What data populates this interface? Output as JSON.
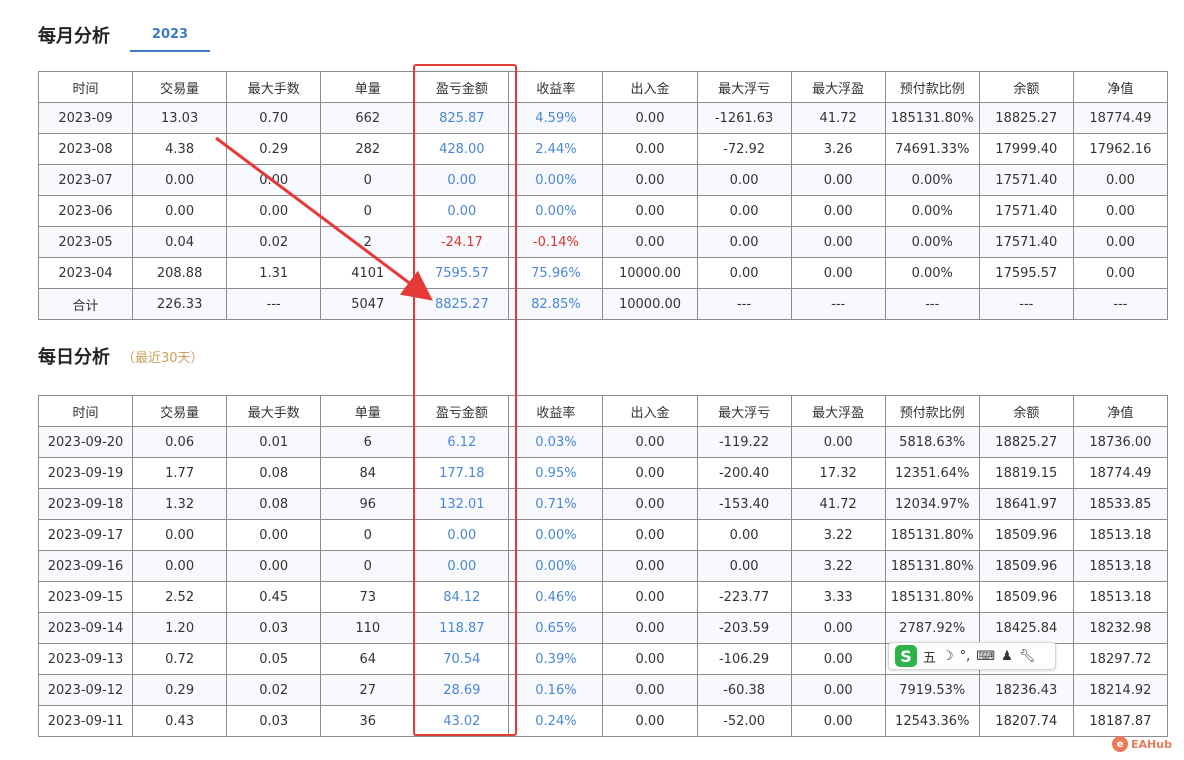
{
  "monthly": {
    "title": "每月分析",
    "year_tab": "2023",
    "headers": [
      "时间",
      "交易量",
      "最大手数",
      "单量",
      "盈亏金额",
      "收益率",
      "出入金",
      "最大浮亏",
      "最大浮盈",
      "预付款比例",
      "余额",
      "净值"
    ],
    "rows": [
      [
        "2023-09",
        "13.03",
        "0.70",
        "662",
        "825.87",
        "4.59%",
        "0.00",
        "-1261.63",
        "41.72",
        "185131.80%",
        "18825.27",
        "18774.49"
      ],
      [
        "2023-08",
        "4.38",
        "0.29",
        "282",
        "428.00",
        "2.44%",
        "0.00",
        "-72.92",
        "3.26",
        "74691.33%",
        "17999.40",
        "17962.16"
      ],
      [
        "2023-07",
        "0.00",
        "0.00",
        "0",
        "0.00",
        "0.00%",
        "0.00",
        "0.00",
        "0.00",
        "0.00%",
        "17571.40",
        "0.00"
      ],
      [
        "2023-06",
        "0.00",
        "0.00",
        "0",
        "0.00",
        "0.00%",
        "0.00",
        "0.00",
        "0.00",
        "0.00%",
        "17571.40",
        "0.00"
      ],
      [
        "2023-05",
        "0.04",
        "0.02",
        "2",
        "-24.17",
        "-0.14%",
        "0.00",
        "0.00",
        "0.00",
        "0.00%",
        "17571.40",
        "0.00"
      ],
      [
        "2023-04",
        "208.88",
        "1.31",
        "4101",
        "7595.57",
        "75.96%",
        "10000.00",
        "0.00",
        "0.00",
        "0.00%",
        "17595.57",
        "0.00"
      ],
      [
        "合计",
        "226.33",
        "---",
        "5047",
        "8825.27",
        "82.85%",
        "10000.00",
        "---",
        "---",
        "---",
        "---",
        "---"
      ]
    ]
  },
  "daily": {
    "title": "每日分析",
    "subtitle": "（最近30天）",
    "headers": [
      "时间",
      "交易量",
      "最大手数",
      "单量",
      "盈亏金额",
      "收益率",
      "出入金",
      "最大浮亏",
      "最大浮盈",
      "预付款比例",
      "余额",
      "净值"
    ],
    "rows": [
      [
        "2023-09-20",
        "0.06",
        "0.01",
        "6",
        "6.12",
        "0.03%",
        "0.00",
        "-119.22",
        "0.00",
        "5818.63%",
        "18825.27",
        "18736.00"
      ],
      [
        "2023-09-19",
        "1.77",
        "0.08",
        "84",
        "177.18",
        "0.95%",
        "0.00",
        "-200.40",
        "17.32",
        "12351.64%",
        "18819.15",
        "18774.49"
      ],
      [
        "2023-09-18",
        "1.32",
        "0.08",
        "96",
        "132.01",
        "0.71%",
        "0.00",
        "-153.40",
        "41.72",
        "12034.97%",
        "18641.97",
        "18533.85"
      ],
      [
        "2023-09-17",
        "0.00",
        "0.00",
        "0",
        "0.00",
        "0.00%",
        "0.00",
        "0.00",
        "3.22",
        "185131.80%",
        "18509.96",
        "18513.18"
      ],
      [
        "2023-09-16",
        "0.00",
        "0.00",
        "0",
        "0.00",
        "0.00%",
        "0.00",
        "0.00",
        "3.22",
        "185131.80%",
        "18509.96",
        "18513.18"
      ],
      [
        "2023-09-15",
        "2.52",
        "0.45",
        "73",
        "84.12",
        "0.46%",
        "0.00",
        "-223.77",
        "3.33",
        "185131.80%",
        "18509.96",
        "18513.18"
      ],
      [
        "2023-09-14",
        "1.20",
        "0.03",
        "110",
        "118.87",
        "0.65%",
        "0.00",
        "-203.59",
        "0.00",
        "2787.92%",
        "18425.84",
        "18232.98"
      ],
      [
        "2023-09-13",
        "0.72",
        "0.05",
        "64",
        "70.54",
        "0.39%",
        "0.00",
        "-106.29",
        "0.00",
        "",
        "",
        "18297.72"
      ],
      [
        "2023-09-12",
        "0.29",
        "0.02",
        "27",
        "28.69",
        "0.16%",
        "0.00",
        "-60.38",
        "0.00",
        "7919.53%",
        "18236.43",
        "18214.92"
      ],
      [
        "2023-09-11",
        "0.43",
        "0.03",
        "36",
        "43.02",
        "0.24%",
        "0.00",
        "-52.00",
        "0.00",
        "12543.36%",
        "18207.74",
        "18187.87"
      ]
    ]
  },
  "ime": {
    "mode_label": "五",
    "logo": "S"
  },
  "watermark": {
    "text": "EAHub",
    "badge": "e"
  },
  "colors": {
    "positive": "#4a86d8",
    "negative": "#e03030",
    "highlight": "#e53935",
    "tab": "#3b7cc4"
  }
}
